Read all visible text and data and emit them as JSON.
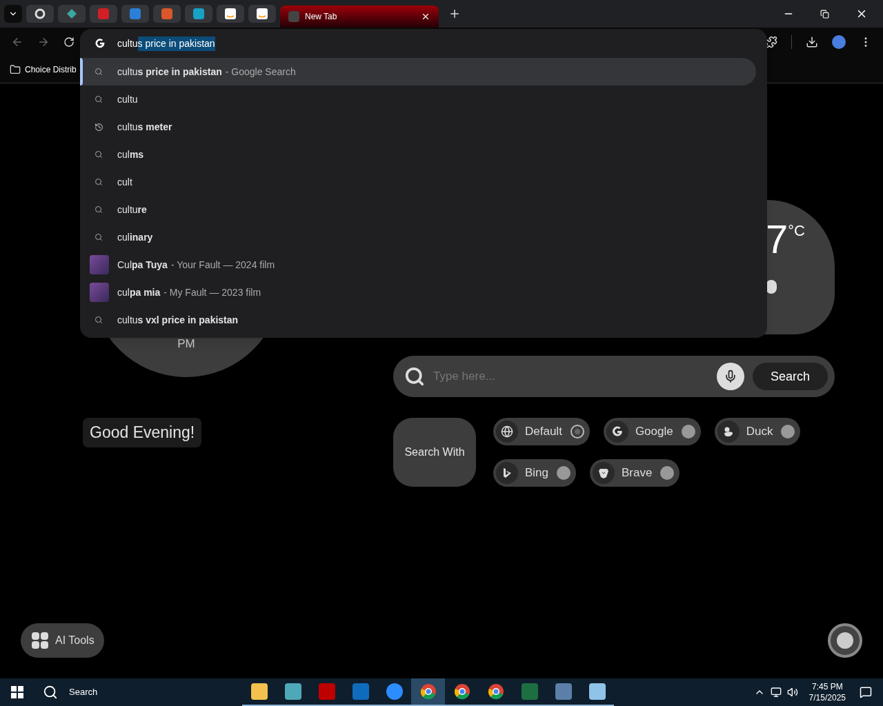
{
  "tabs": [
    {
      "kind": "ring",
      "selected": false
    },
    {
      "kind": "diamond",
      "selected": false
    },
    {
      "kind": "red",
      "selected": false
    },
    {
      "kind": "blue",
      "selected": false
    },
    {
      "kind": "box",
      "selected": false
    },
    {
      "kind": "teal",
      "selected": false
    },
    {
      "kind": "amazon",
      "selected": false
    },
    {
      "kind": "amazon",
      "selected": false
    },
    {
      "kind": "page",
      "label": "New Tab",
      "selected": true
    }
  ],
  "bookmarks": [
    {
      "label": "Choice Distrib"
    }
  ],
  "omnibox": {
    "typed": "cultu",
    "completion": "s price in pakistan"
  },
  "suggestions": [
    {
      "kind": "search",
      "text": "cultu**s price in pakistan**",
      "detail": "- Google Search",
      "selected": true
    },
    {
      "kind": "search",
      "text": "cultu",
      "selected": false
    },
    {
      "kind": "history",
      "text": "cultu**s meter**",
      "selected": false
    },
    {
      "kind": "search",
      "text": "cul**ms**",
      "selected": false
    },
    {
      "kind": "search",
      "text": "cult",
      "selected": false
    },
    {
      "kind": "search",
      "text": "cultu**re**",
      "selected": false
    },
    {
      "kind": "search",
      "text": "cul**inary**",
      "selected": false
    },
    {
      "kind": "entity",
      "text": "Cul**pa Tuya**",
      "detail": "- Your Fault — 2024 film",
      "selected": false
    },
    {
      "kind": "entity",
      "text": "cul**pa mia**",
      "detail": "- My Fault — 2023 film",
      "selected": false
    },
    {
      "kind": "search",
      "text": "cultu**s vxl price in pakistan**",
      "selected": false
    }
  ],
  "clock": {
    "period": "PM"
  },
  "weather": {
    "temperature": "7",
    "unit": "°C"
  },
  "greeting": "Good Evening!",
  "search": {
    "placeholder": "Type here...",
    "button": "Search"
  },
  "search_with": {
    "label": "Search With",
    "engines": [
      {
        "kind": "globe",
        "label": "Default",
        "selected": true
      },
      {
        "kind": "google",
        "label": "Google",
        "selected": false
      },
      {
        "kind": "duck",
        "label": "Duck",
        "selected": false
      },
      {
        "kind": "bing",
        "label": "Bing",
        "selected": false
      },
      {
        "kind": "brave",
        "label": "Brave",
        "selected": false
      }
    ]
  },
  "ai_tools": {
    "label": "AI Tools"
  },
  "taskbar": {
    "search": "Search",
    "apps": [
      {
        "kind": "folder",
        "active": false
      },
      {
        "kind": "diamond",
        "active": false
      },
      {
        "kind": "filezilla",
        "active": false
      },
      {
        "kind": "outlook",
        "active": false
      },
      {
        "kind": "zoom",
        "active": false
      },
      {
        "kind": "chrome",
        "active": true
      },
      {
        "kind": "chrome",
        "active": false
      },
      {
        "kind": "chrome",
        "active": false
      },
      {
        "kind": "excel",
        "active": false
      },
      {
        "kind": "calculator",
        "active": false
      },
      {
        "kind": "notepad",
        "active": false
      }
    ],
    "time": "7:45 PM",
    "date": "7/15/2025"
  }
}
